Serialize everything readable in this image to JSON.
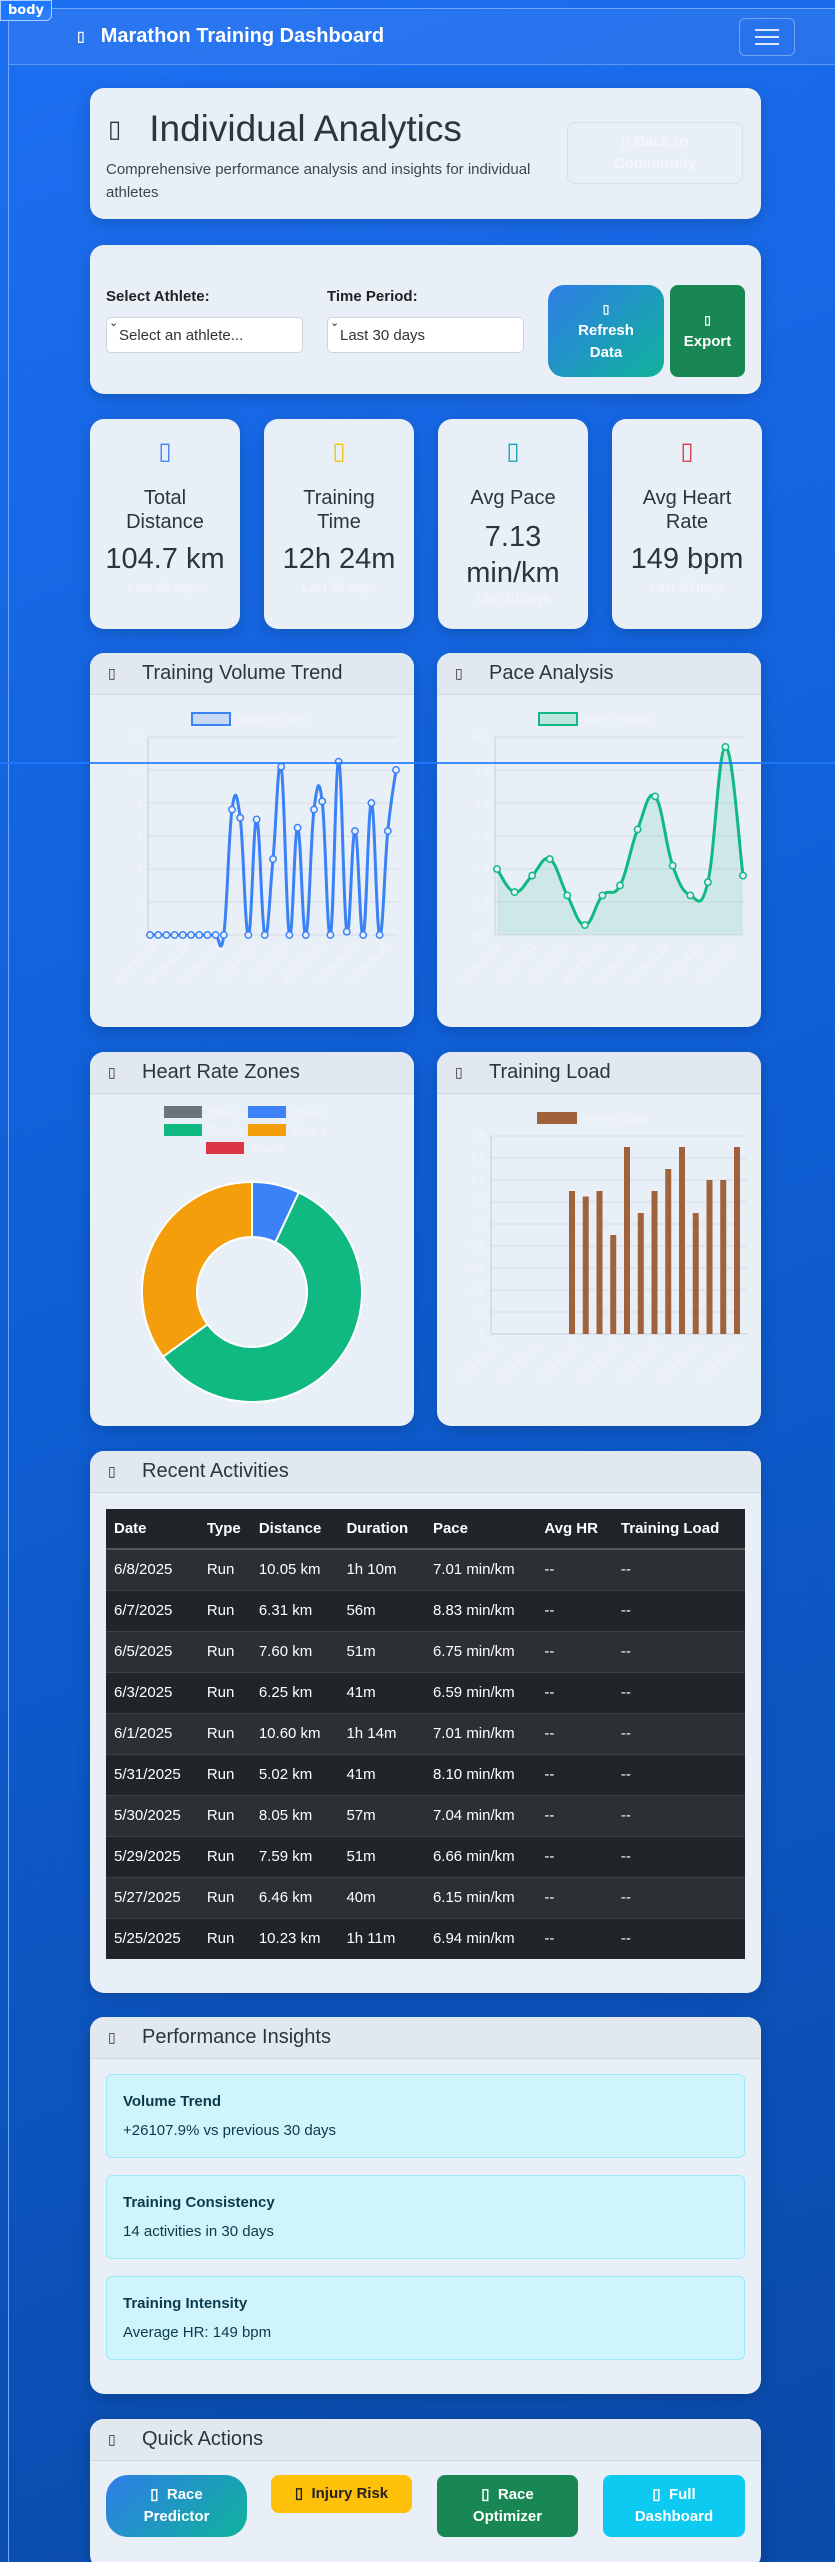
{
  "debug_tag": "body",
  "navbar": {
    "icon": "running-icon",
    "title": "Marathon Training Dashboard"
  },
  "header": {
    "icon": "chart-icon",
    "title": "Individual Analytics",
    "subtitle": "Comprehensive performance analysis and insights for individual athletes",
    "back_icon": "arrow-left-icon",
    "back_label_line1": "Back to",
    "back_label_line2": "Community"
  },
  "controls": {
    "athlete_label": "Select Athlete:",
    "athlete_value": "Select an athlete...",
    "period_label": "Time Period:",
    "period_value": "Last 30 days",
    "refresh_line1": "Refresh",
    "refresh_line2": "Data",
    "export_label": "Export"
  },
  "stats": [
    {
      "icon": "route-icon",
      "color": "#3b82f6",
      "label1": "Total",
      "label2": "Distance",
      "value1": "104.7 km",
      "value2": "",
      "sub": "Last 30 days"
    },
    {
      "icon": "clock-icon",
      "color": "#f1c40f",
      "label1": "Training",
      "label2": "Time",
      "value1": "12h 24m",
      "value2": "",
      "sub": "Last 30 days"
    },
    {
      "icon": "speedometer-icon",
      "color": "#17a2b8",
      "label1": "Avg Pace",
      "label2": "",
      "value1": "7.13",
      "value2": "min/km",
      "sub": "Last 30 days"
    },
    {
      "icon": "heart-icon",
      "color": "#dc3545",
      "label1": "Avg Heart",
      "label2": "Rate",
      "value1": "149 bpm",
      "value2": "",
      "sub": "Last 30 days"
    }
  ],
  "panels": {
    "volume": "Training Volume Trend",
    "pace": "Pace Analysis",
    "hr": "Heart Rate Zones",
    "load": "Training Load",
    "recent": "Recent Activities",
    "insights": "Performance Insights",
    "quick": "Quick Actions"
  },
  "chart_data": [
    {
      "type": "line",
      "legend": [
        "Distance (km)"
      ],
      "x_ticks": [
        "2025-05-08",
        "2025-05-12",
        "2025-05-16",
        "2025-05-20",
        "2025-05-24",
        "2025-05-28",
        "2025-06-01",
        "2025-06-05"
      ],
      "ylim": [
        0,
        12
      ],
      "y_ticks": [
        "0",
        "2",
        "4",
        "6",
        "8",
        "10",
        "12"
      ],
      "values": [
        0,
        0,
        0,
        0,
        0,
        0,
        0,
        0,
        0,
        0,
        7.6,
        7.1,
        0,
        7,
        0,
        4.6,
        10.2,
        0,
        6.5,
        0,
        7.6,
        8.1,
        0,
        10.5,
        0.2,
        6.3,
        0,
        8,
        0,
        6.3,
        10
      ]
    },
    {
      "type": "line",
      "legend": [
        "Pace (min/km)"
      ],
      "x_ticks": [
        "2025-05-08",
        "2025-05-12",
        "2025-05-16",
        "2025-05-20",
        "2025-05-24",
        "2025-05-28",
        "2025-06-01",
        "2025-06-05"
      ],
      "ylim": [
        6.0,
        9.0
      ],
      "y_ticks": [
        "6.0",
        "6.5",
        "7.0",
        "7.5",
        "8.0",
        "8.5",
        "9.0"
      ],
      "values": [
        7.0,
        6.65,
        6.9,
        7.15,
        6.6,
        6.15,
        6.6,
        6.75,
        7.6,
        8.1,
        7.05,
        6.6,
        6.8,
        8.85,
        6.9
      ]
    },
    {
      "type": "pie",
      "legend": [
        "Zone 1",
        "Zone 2",
        "Zone 3",
        "Zone 4",
        "Zone 5"
      ],
      "colors": [
        "#6c757d",
        "#3b82f6",
        "#10b981",
        "#f59e0b",
        "#dc3545"
      ],
      "values": [
        0,
        7,
        58,
        35,
        0
      ]
    },
    {
      "type": "bar",
      "legend": [
        "Training Load"
      ],
      "x_ticks": [
        "2025-05-12",
        "2025-05-16",
        "2025-05-20",
        "2025-05-24",
        "2025-05-28",
        "2025-06-01",
        "2025-06-05"
      ],
      "ylim": [
        0,
        1.8
      ],
      "y_ticks": [
        "0",
        "0.2",
        "0.4",
        "0.6",
        "0.8",
        "1.0",
        "1.2",
        "1.4",
        "1.6",
        "1.8"
      ],
      "values": [
        1.3,
        1.25,
        1.3,
        0.9,
        1.7,
        1.1,
        1.3,
        1.5,
        1.7,
        1.1,
        1.4,
        1.4,
        1.7
      ]
    }
  ],
  "activities": {
    "columns": [
      "Date",
      "Type",
      "Distance",
      "Duration",
      "Pace",
      "Avg HR",
      "Training Load"
    ],
    "rows": [
      [
        "6/8/2025",
        "Run",
        "10.05 km",
        "1h 10m",
        "7.01 min/km",
        "--",
        "--"
      ],
      [
        "6/7/2025",
        "Run",
        "6.31 km",
        "56m",
        "8.83 min/km",
        "--",
        "--"
      ],
      [
        "6/5/2025",
        "Run",
        "7.60 km",
        "51m",
        "6.75 min/km",
        "--",
        "--"
      ],
      [
        "6/3/2025",
        "Run",
        "6.25 km",
        "41m",
        "6.59 min/km",
        "--",
        "--"
      ],
      [
        "6/1/2025",
        "Run",
        "10.60 km",
        "1h 14m",
        "7.01 min/km",
        "--",
        "--"
      ],
      [
        "5/31/2025",
        "Run",
        "5.02 km",
        "41m",
        "8.10 min/km",
        "--",
        "--"
      ],
      [
        "5/30/2025",
        "Run",
        "8.05 km",
        "57m",
        "7.04 min/km",
        "--",
        "--"
      ],
      [
        "5/29/2025",
        "Run",
        "7.59 km",
        "51m",
        "6.66 min/km",
        "--",
        "--"
      ],
      [
        "5/27/2025",
        "Run",
        "6.46 km",
        "40m",
        "6.15 min/km",
        "--",
        "--"
      ],
      [
        "5/25/2025",
        "Run",
        "10.23 km",
        "1h 11m",
        "6.94 min/km",
        "--",
        "--"
      ]
    ]
  },
  "insights": [
    {
      "title": "Volume Trend",
      "value": "+26107.9% vs previous 30 days"
    },
    {
      "title": "Training Consistency",
      "value": "14 activities in 30 days"
    },
    {
      "title": "Training Intensity",
      "value": "Average HR: 149 bpm"
    }
  ],
  "quick_actions": [
    {
      "icon": "flag-icon",
      "line1": "Race",
      "line2": "Predictor"
    },
    {
      "icon": "medkit-icon",
      "line1": "Injury Risk",
      "line2": ""
    },
    {
      "icon": "sliders-icon",
      "line1": "Race",
      "line2": "Optimizer"
    },
    {
      "icon": "dashboard-icon",
      "line1": "Full",
      "line2": "Dashboard"
    }
  ]
}
